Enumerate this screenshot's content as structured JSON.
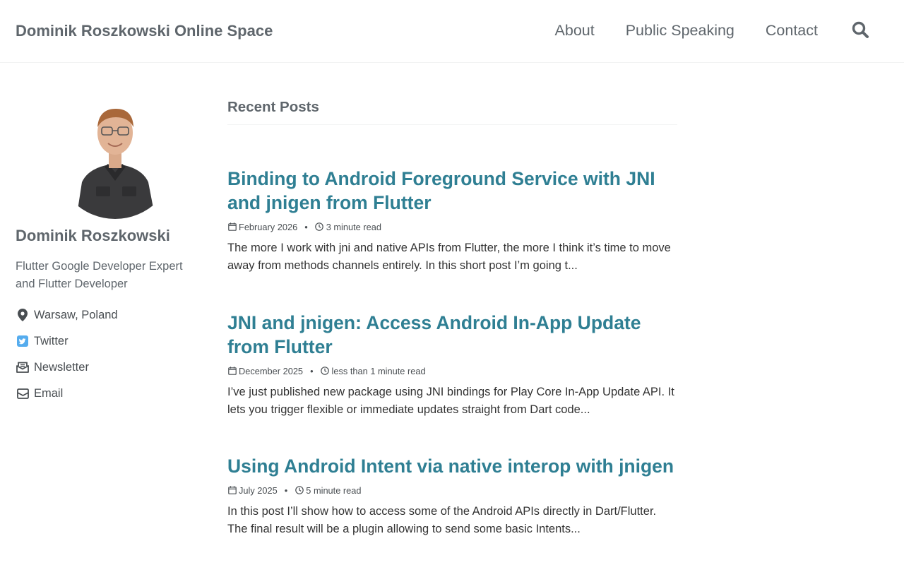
{
  "masthead": {
    "site_title": "Dominik Roszkowski Online Space",
    "nav": [
      "About",
      "Public Speaking",
      "Contact"
    ],
    "search_icon": "search-icon"
  },
  "sidebar": {
    "name": "Dominik Roszkowski",
    "bio": "Flutter Google Developer Expert and Flutter Developer",
    "links": [
      {
        "icon": "location-pin-icon",
        "label": "Warsaw, Poland"
      },
      {
        "icon": "twitter-icon",
        "label": "Twitter"
      },
      {
        "icon": "newsletter-icon",
        "label": "Newsletter"
      },
      {
        "icon": "email-icon",
        "label": "Email"
      }
    ]
  },
  "main": {
    "heading": "Recent Posts",
    "posts": [
      {
        "title": "Binding to Android Foreground Service with JNI and jnigen from Flutter",
        "date": "February 2026",
        "read_time": "3 minute read",
        "excerpt": "The more I work with jni and native APIs from Flutter, the more I think it’s time to move away from methods channels entirely. In this short post I’m going t..."
      },
      {
        "title": "JNI and jnigen: Access Android In-App Update from Flutter",
        "date": "December 2025",
        "read_time": "less than 1 minute read",
        "excerpt": "I’ve just published new package using JNI bindings for Play Core In-App Update API. It lets you trigger flexible or immediate updates straight from Dart code..."
      },
      {
        "title": "Using Android Intent via native interop with jnigen",
        "date": "July 2025",
        "read_time": "5 minute read",
        "excerpt": "In this post I’ll show how to access some of the Android APIs directly in Dart/Flutter. The final result will be a plugin allowing to send some basic Intents..."
      }
    ]
  },
  "colors": {
    "link_accent": "#2f7f93",
    "muted_text": "#5f666c",
    "twitter_blue": "#55acee"
  }
}
